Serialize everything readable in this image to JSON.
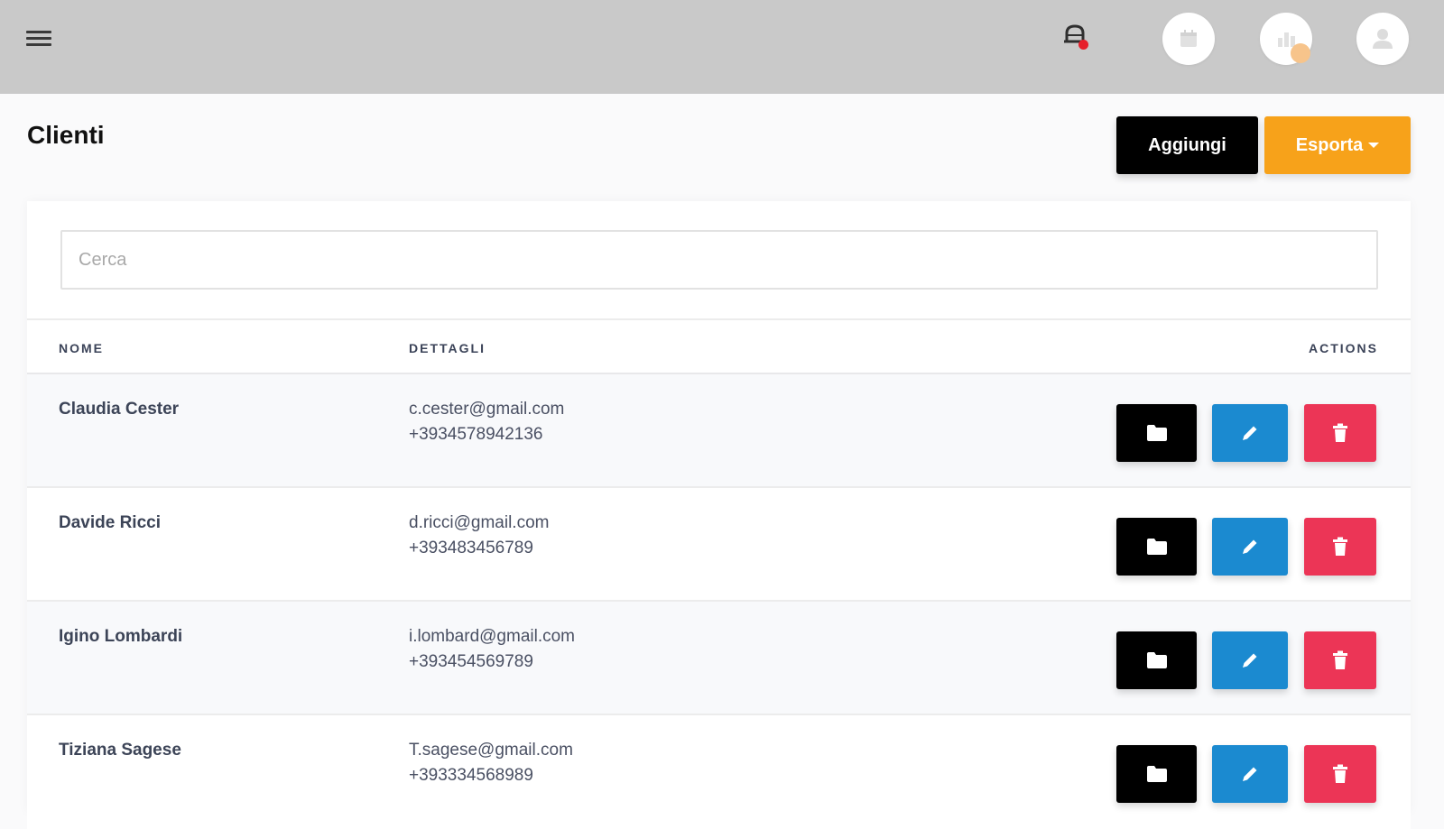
{
  "header": {
    "icons": [
      "menu-icon",
      "notification-bell-icon",
      "calendar-icon",
      "chart-icon",
      "user-icon"
    ],
    "colors": {
      "bar": "#c9c9c9",
      "notification_dot": "#e6202b"
    }
  },
  "page": {
    "title": "Clienti",
    "add_label": "Aggiungi",
    "export_label": "Esporta",
    "colors": {
      "add": "#000000",
      "export": "#f7a21a"
    }
  },
  "search": {
    "placeholder": "Cerca",
    "value": ""
  },
  "table": {
    "columns": [
      "NOME",
      "DETTAGLI",
      "ACTIONS"
    ],
    "rows": [
      {
        "name": "Claudia Cester",
        "email": "c.cester@gmail.com",
        "phone": "+3934578942136"
      },
      {
        "name": "Davide Ricci",
        "email": "d.ricci@gmail.com",
        "phone": "+393483456789"
      },
      {
        "name": "Igino Lombardi",
        "email": "i.lombard@gmail.com",
        "phone": "+393454569789"
      },
      {
        "name": "Tiziana Sagese",
        "email": "T.sagese@gmail.com",
        "phone": "+393334568989"
      }
    ],
    "action_icons": [
      "folder-icon",
      "pencil-icon",
      "trash-icon"
    ],
    "colors": {
      "open": "#000000",
      "edit": "#1b8ad0",
      "delete": "#ec3556"
    }
  }
}
